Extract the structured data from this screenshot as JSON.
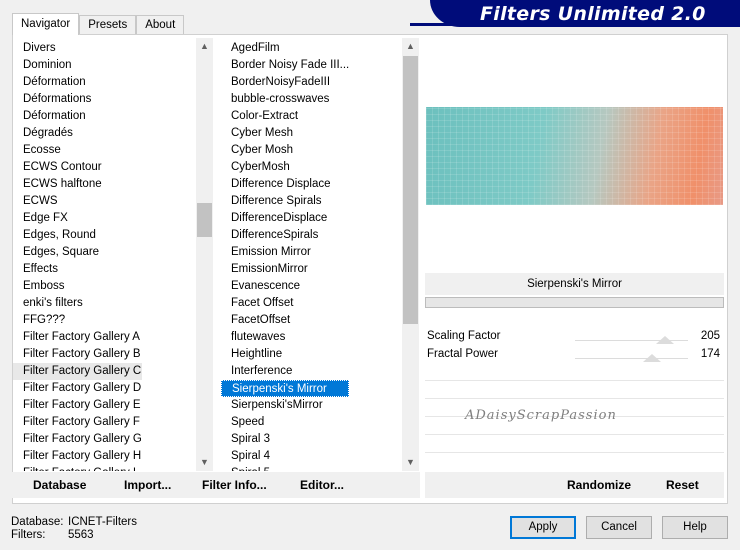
{
  "app": {
    "title": "Filters Unlimited 2.0"
  },
  "tabs": [
    {
      "label": "Navigator",
      "active": true
    },
    {
      "label": "Presets",
      "active": false
    },
    {
      "label": "About",
      "active": false
    }
  ],
  "categories": {
    "items": [
      "Divers",
      "Dominion",
      "Déformation",
      "Déformations",
      "Déformation",
      "Dégradés",
      "Ecosse",
      "ECWS Contour",
      "ECWS halftone",
      "ECWS",
      "Edge FX",
      "Edges, Round",
      "Edges, Square",
      "Effects",
      "Emboss",
      "enki's filters",
      "FFG???",
      "Filter Factory Gallery A",
      "Filter Factory Gallery B",
      "Filter Factory Gallery C",
      "Filter Factory Gallery D",
      "Filter Factory Gallery E",
      "Filter Factory Gallery F",
      "Filter Factory Gallery G",
      "Filter Factory Gallery H",
      "Filter Factory Gallery I"
    ],
    "current": "Filter Factory Gallery C"
  },
  "filters": {
    "items": [
      "AgedFilm",
      "Border Noisy Fade III...",
      "BorderNoisyFadeIII",
      "bubble-crosswaves",
      "Color-Extract",
      "Cyber Mesh",
      "Cyber Mosh",
      "CyberMosh",
      "Difference Displace",
      "Difference Spirals",
      "DifferenceDisplace",
      "DifferenceSpirals",
      "Emission Mirror",
      "EmissionMirror",
      "Evanescence",
      "Facet Offset",
      "FacetOffset",
      "flutewaves",
      "Heightline",
      "Interference",
      "Sierpenski's Mirror",
      "Sierpenski'sMirror",
      "Speed",
      "Spiral 3",
      "Spiral 4",
      "Spiral 5"
    ],
    "selected": "Sierpenski's Mirror"
  },
  "preview": {
    "filter_name": "Sierpenski's Mirror"
  },
  "params": [
    {
      "name": "Scaling Factor",
      "value": "205",
      "level": 0.8
    },
    {
      "name": "Fractal Power",
      "value": "174",
      "level": 0.68
    }
  ],
  "watermark": "ADaisyScrapPassion",
  "toolbar": {
    "database": "Database",
    "import": "Import...",
    "filter_info": "Filter Info...",
    "editor": "Editor...",
    "randomize": "Randomize",
    "reset": "Reset"
  },
  "footer": {
    "database_label": "Database:",
    "database_value": "ICNET-Filters",
    "filters_label": "Filters:",
    "filters_value": "5563"
  },
  "buttons": {
    "apply": "Apply",
    "cancel": "Cancel",
    "help": "Help"
  },
  "colors": {
    "banner": "#000c7a",
    "selection": "#0078d7"
  }
}
